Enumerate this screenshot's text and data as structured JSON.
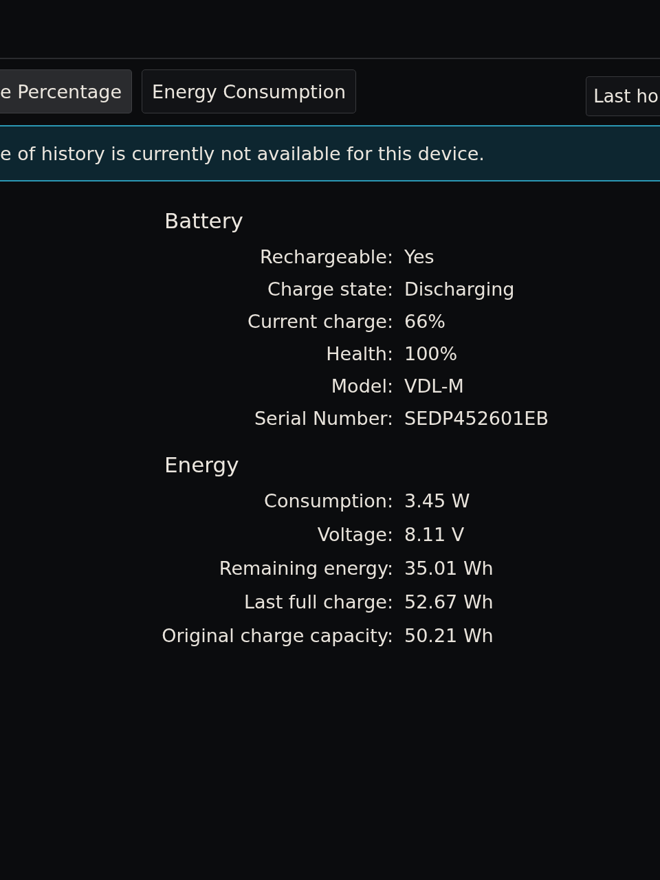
{
  "tabs": [
    {
      "label": "e Percentage",
      "selected": true
    },
    {
      "label": "Energy Consumption",
      "selected": false
    }
  ],
  "time_range_button": {
    "label": "Last ho"
  },
  "banner": {
    "text": "e of history is currently not available for this device."
  },
  "sections": [
    {
      "title": "Battery",
      "fields": [
        {
          "label": "Rechargeable:",
          "value": "Yes"
        },
        {
          "label": "Charge state:",
          "value": "Discharging"
        },
        {
          "label": "Current charge:",
          "value": "66%"
        },
        {
          "label": "Health:",
          "value": "100%"
        },
        {
          "label": "Model:",
          "value": "VDL-M"
        },
        {
          "label": "Serial Number:",
          "value": "SEDP452601EB"
        }
      ]
    },
    {
      "title": "Energy",
      "fields": [
        {
          "label": "Consumption:",
          "value": "3.45 W"
        },
        {
          "label": "Voltage:",
          "value": "8.11 V"
        },
        {
          "label": "Remaining energy:",
          "value": "35.01 Wh"
        },
        {
          "label": "Last full charge:",
          "value": "52.67 Wh"
        },
        {
          "label": "Original charge capacity:",
          "value": "50.21 Wh"
        }
      ]
    }
  ]
}
